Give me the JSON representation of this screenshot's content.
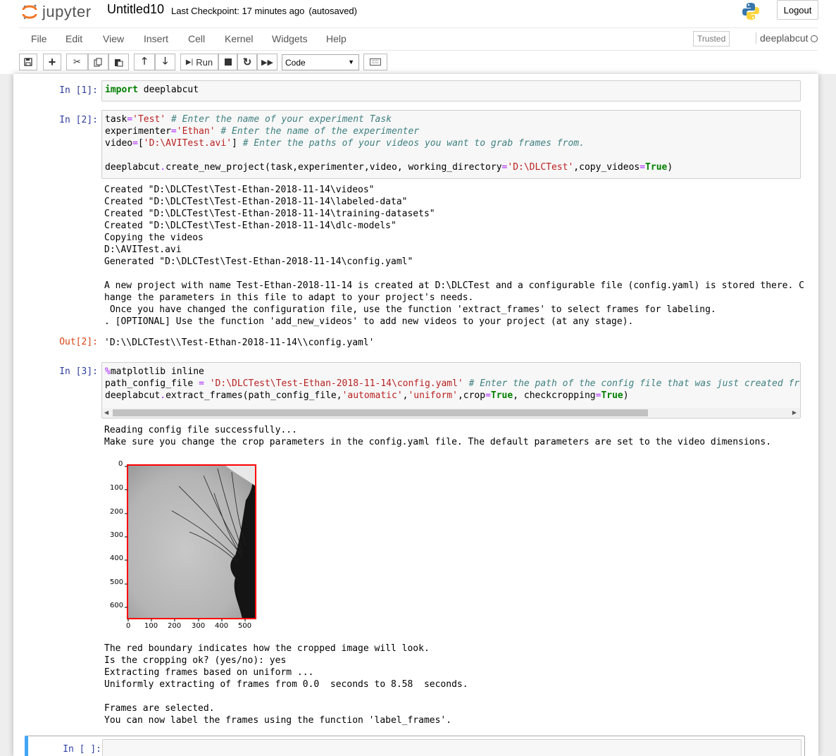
{
  "header": {
    "logo_text": "jupyter",
    "notebook_name": "Untitled10",
    "checkpoint": "Last Checkpoint: 17 minutes ago",
    "autosave": "(autosaved)",
    "logout": "Logout"
  },
  "menu": [
    "File",
    "Edit",
    "View",
    "Insert",
    "Cell",
    "Kernel",
    "Widgets",
    "Help"
  ],
  "trusted": "Trusted",
  "kernel": "deeplabcut",
  "toolbar": {
    "run_label": "Run",
    "cell_type": "Code"
  },
  "cells": [
    {
      "prompt": "In [1]:"
    },
    {
      "prompt": "In [2]:"
    },
    {
      "prompt": "Out[2]:",
      "value": "'D:\\\\DLCTest\\\\Test-Ethan-2018-11-14\\\\config.yaml'"
    },
    {
      "prompt": "In [3]:"
    },
    {
      "prompt": "In [ ]:"
    }
  ],
  "outputs": {
    "cell2": [
      "Created \"D:\\DLCTest\\Test-Ethan-2018-11-14\\videos\"",
      "Created \"D:\\DLCTest\\Test-Ethan-2018-11-14\\labeled-data\"",
      "Created \"D:\\DLCTest\\Test-Ethan-2018-11-14\\training-datasets\"",
      "Created \"D:\\DLCTest\\Test-Ethan-2018-11-14\\dlc-models\"",
      "Copying the videos",
      "D:\\AVITest.avi",
      "Generated \"D:\\DLCTest\\Test-Ethan-2018-11-14\\config.yaml\"",
      "",
      "A new project with name Test-Ethan-2018-11-14 is created at D:\\DLCTest and a configurable file (config.yaml) is stored there. C",
      "hange the parameters in this file to adapt to your project's needs.",
      " Once you have changed the configuration file, use the function 'extract_frames' to select frames for labeling.",
      ". [OPTIONAL] Use the function 'add_new_videos' to add new videos to your project (at any stage)."
    ],
    "cell3_before": [
      "Reading config file successfully...",
      "Make sure you change the crop parameters in the config.yaml file. The default parameters are set to the video dimensions."
    ],
    "cell3_after": [
      "The red boundary indicates how the cropped image will look.",
      "Is the cropping ok? (yes/no): yes",
      "Extracting frames based on uniform ...",
      "Uniformly extracting of frames from 0.0  seconds to 8.58  seconds.",
      "",
      "Frames are selected.",
      "You can now label the frames using the function 'label_frames'."
    ]
  },
  "plot": {
    "y_ticks": [
      "0",
      "100",
      "200",
      "300",
      "400",
      "500",
      "600"
    ],
    "x_ticks": [
      "0",
      "100",
      "200",
      "300",
      "400",
      "500"
    ],
    "boundary_color": "#ff0000"
  }
}
